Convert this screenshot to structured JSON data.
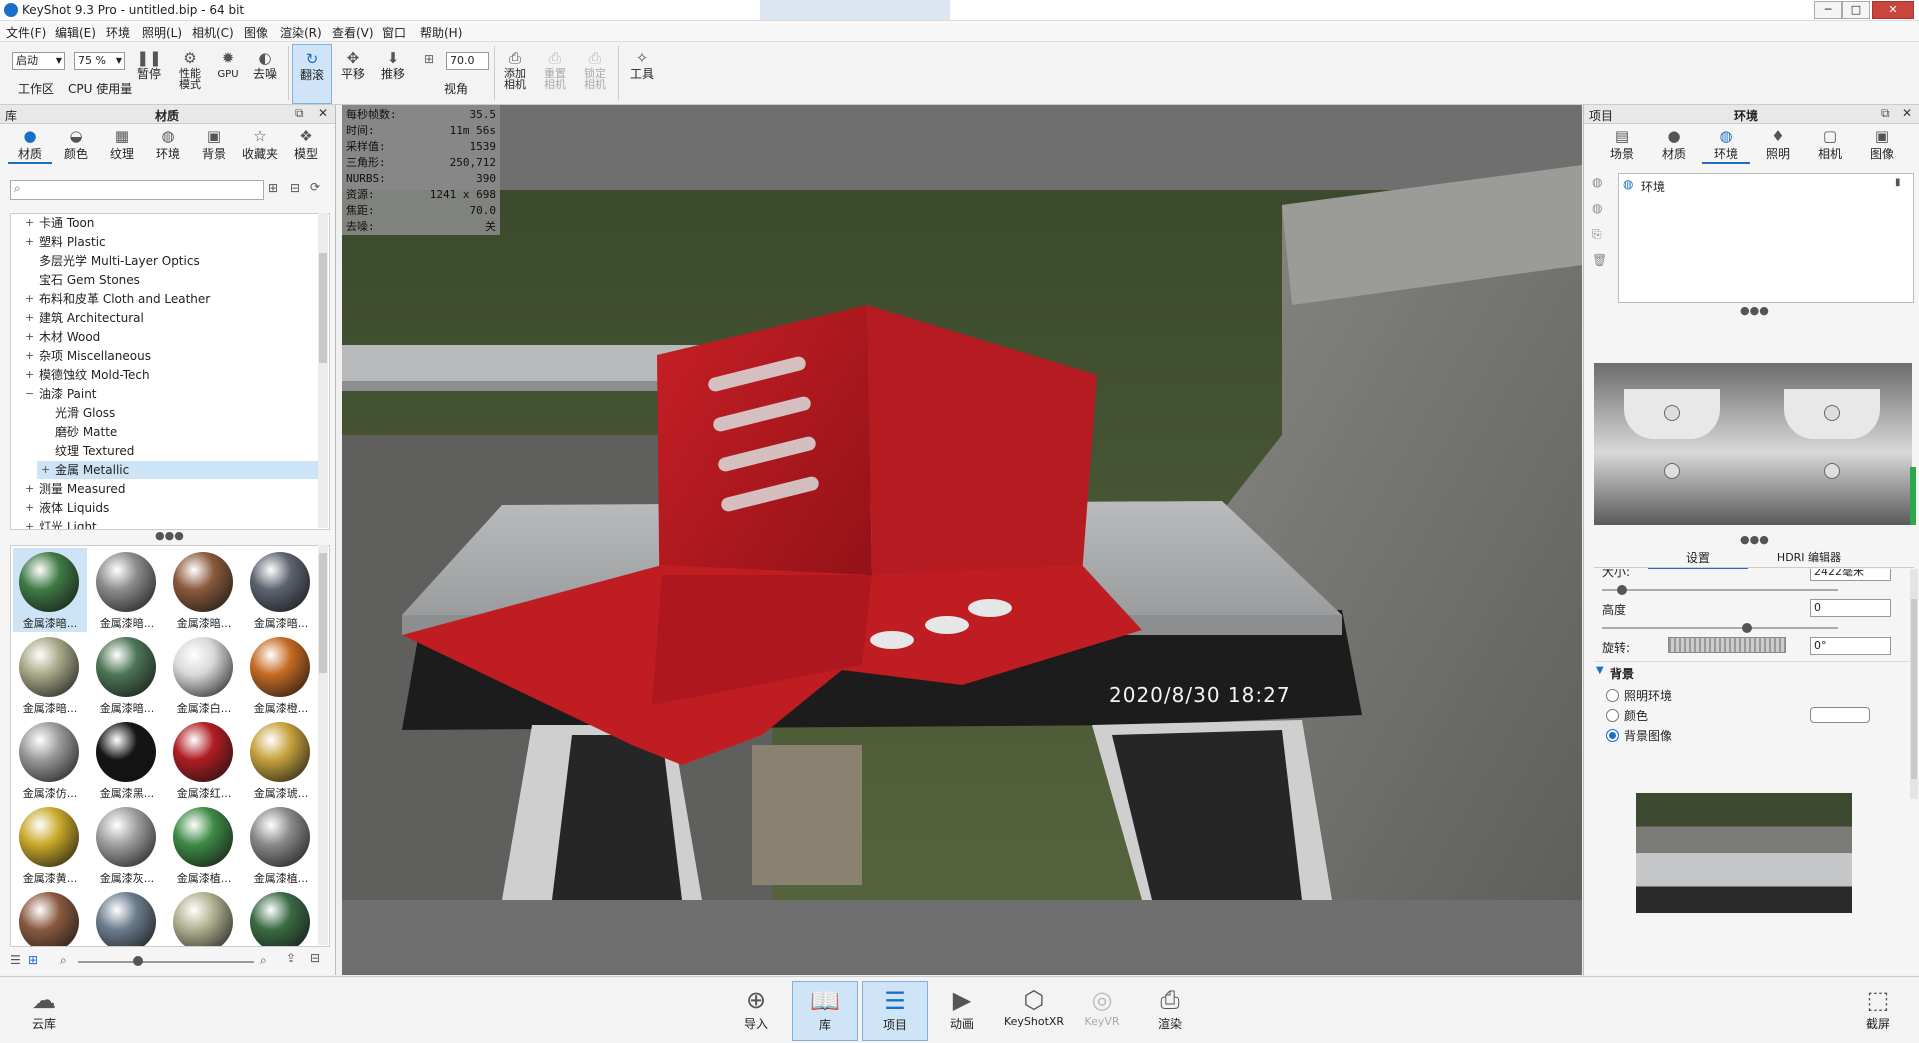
{
  "window": {
    "title": "KeyShot 9.3 Pro  - untitled.bip  - 64 bit",
    "minimize": "─",
    "maximize": "□",
    "close": "✕"
  },
  "menu": [
    "文件(F)",
    "编辑(E)",
    "环境",
    "照明(L)",
    "相机(C)",
    "图像",
    "渲染(R)",
    "查看(V)",
    "窗口",
    "帮助(H)"
  ],
  "toolbar": {
    "workspace_value": "启动",
    "workspace_label": "工作区",
    "cpu_value": "75 %",
    "cpu_label": "CPU 使用量",
    "pause_label": "暂停",
    "perf_label": "性能\n模式",
    "gpu_label": "GPU",
    "denoise_label": "去噪",
    "tumble_label": "翻滚",
    "pan_label": "平移",
    "dolly_label": "推移",
    "fov_value": "70.0",
    "fov_label": "视角",
    "add_camera_label": "添加\n相机",
    "reset_camera_label": "重置\n相机",
    "lock_camera_label": "锁定\n相机",
    "tools_label": "工具"
  },
  "library": {
    "header_left": "库",
    "header_title": "材质",
    "tabs": [
      "材质",
      "颜色",
      "纹理",
      "环境",
      "背景",
      "收藏夹",
      "模型"
    ],
    "search_placeholder": "",
    "tree": [
      {
        "label": "卡通 Toon",
        "indent": 0,
        "expand": true
      },
      {
        "label": "塑料 Plastic",
        "indent": 0,
        "expand": true
      },
      {
        "label": "多层光学 Multi-Layer Optics",
        "indent": 0,
        "expand": false
      },
      {
        "label": "宝石 Gem Stones",
        "indent": 0,
        "expand": false
      },
      {
        "label": "布料和皮革 Cloth and Leather",
        "indent": 0,
        "expand": true
      },
      {
        "label": "建筑 Architectural",
        "indent": 0,
        "expand": true
      },
      {
        "label": "木材 Wood",
        "indent": 0,
        "expand": true
      },
      {
        "label": "杂项 Miscellaneous",
        "indent": 0,
        "expand": true
      },
      {
        "label": "模德蚀纹 Mold-Tech",
        "indent": 0,
        "expand": true
      },
      {
        "label": "油漆 Paint",
        "indent": 0,
        "expand": "open"
      },
      {
        "label": "光滑 Gloss",
        "indent": 1,
        "expand": false
      },
      {
        "label": "磨砂 Matte",
        "indent": 1,
        "expand": false
      },
      {
        "label": "纹理 Textured",
        "indent": 1,
        "expand": false
      },
      {
        "label": "金属 Metallic",
        "indent": 1,
        "expand": true,
        "selected": true
      },
      {
        "label": "测量 Measured",
        "indent": 0,
        "expand": true
      },
      {
        "label": "液体 Liquids",
        "indent": 0,
        "expand": true
      },
      {
        "label": "灯光 Light",
        "indent": 0,
        "expand": true
      }
    ],
    "thumbnails": [
      {
        "label": "金属漆暗...",
        "color": "#3f7a45"
      },
      {
        "label": "金属漆暗...",
        "color": "#8c8c8c"
      },
      {
        "label": "金属漆暗...",
        "color": "#8a5a3c"
      },
      {
        "label": "金属漆暗...",
        "color": "#5c6470"
      },
      {
        "label": "金属漆暗...",
        "color": "#a8a888"
      },
      {
        "label": "金属漆暗...",
        "color": "#4d7555"
      },
      {
        "label": "金属漆白...",
        "color": "#d8d8d8"
      },
      {
        "label": "金属漆橙...",
        "color": "#c66a22"
      },
      {
        "label": "金属漆仿...",
        "color": "#9a9a9a"
      },
      {
        "label": "金属漆黑...",
        "color": "#151515"
      },
      {
        "label": "金属漆红...",
        "color": "#b01d22"
      },
      {
        "label": "金属漆琥...",
        "color": "#c6a23c"
      },
      {
        "label": "金属漆黄...",
        "color": "#c9a92a"
      },
      {
        "label": "金属漆灰...",
        "color": "#a0a0a0"
      },
      {
        "label": "金属漆植...",
        "color": "#3e8a46"
      },
      {
        "label": "金属漆植...",
        "color": "#8a8a8a"
      },
      {
        "label": "",
        "color": "#8a5a40"
      },
      {
        "label": "",
        "color": "#6a7c8c"
      },
      {
        "label": "",
        "color": "#b0b090"
      },
      {
        "label": "",
        "color": "#3a6a44"
      }
    ]
  },
  "viewport": {
    "stats": [
      {
        "k": "每秒帧数:",
        "v": "35.5"
      },
      {
        "k": "时间:",
        "v": "11m 56s"
      },
      {
        "k": "采样值:",
        "v": "1539"
      },
      {
        "k": "三角形:",
        "v": "250,712"
      },
      {
        "k": "NURBS:",
        "v": "390"
      },
      {
        "k": "资源:",
        "v": "1241 x 698"
      },
      {
        "k": "焦距:",
        "v": "70.0"
      },
      {
        "k": "去噪:",
        "v": "关"
      }
    ],
    "timestamp": "2020/8/30  18:27"
  },
  "project": {
    "header_left": "项目",
    "header_title": "环境",
    "tabs": [
      "场景",
      "材质",
      "环境",
      "照明",
      "相机",
      "图像"
    ],
    "env_list": [
      "环境"
    ],
    "subtabs": [
      "设置",
      "HDRI 编辑器"
    ],
    "size_label": "大小:",
    "size_value": "2422毫米",
    "height_label": "高度",
    "height_value": "0",
    "rotation_label": "旋转:",
    "rotation_value": "0°",
    "background_title": "背景",
    "bg_options": [
      {
        "label": "照明环境",
        "checked": false
      },
      {
        "label": "颜色",
        "checked": false
      },
      {
        "label": "背景图像",
        "checked": true
      }
    ]
  },
  "bottombar": {
    "cloud": "云库",
    "import": "导入",
    "library": "库",
    "project": "项目",
    "animation": "动画",
    "keyshotxr": "KeyShotXR",
    "keyvr": "KeyVR",
    "render": "渲染",
    "screenshot": "截屏"
  },
  "colors": {
    "accent": "#1a6fc8",
    "part_red": "#b5161c",
    "table": "#a7a9ab"
  }
}
